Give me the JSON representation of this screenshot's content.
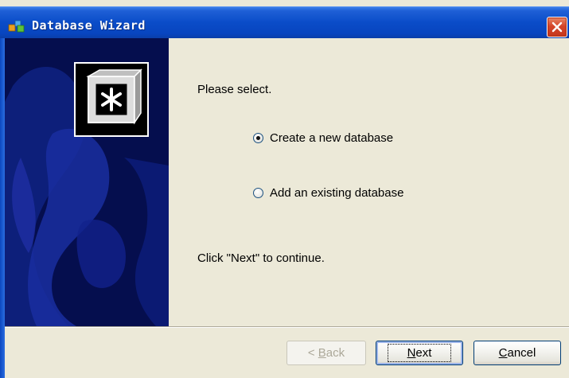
{
  "window": {
    "title": "Database Wizard",
    "close_label": "X"
  },
  "side_panel": {
    "logo_icon": "asterisk-box-icon",
    "background_color": "#050e4e"
  },
  "content": {
    "prompt": "Please select.",
    "options": [
      {
        "label": "Create a new database",
        "checked": true
      },
      {
        "label": "Add an existing database",
        "checked": false
      }
    ],
    "instruction": "Click \"Next\" to continue."
  },
  "buttons": {
    "back_prefix": "< ",
    "back_mnemonic": "B",
    "back_rest": "ack",
    "next_mnemonic": "N",
    "next_rest": "ext",
    "cancel_mnemonic": "C",
    "cancel_rest": "ancel"
  },
  "colors": {
    "titlebar": "#0a4cc8",
    "close": "#d5452a",
    "dialog_bg": "#ece9d8"
  }
}
